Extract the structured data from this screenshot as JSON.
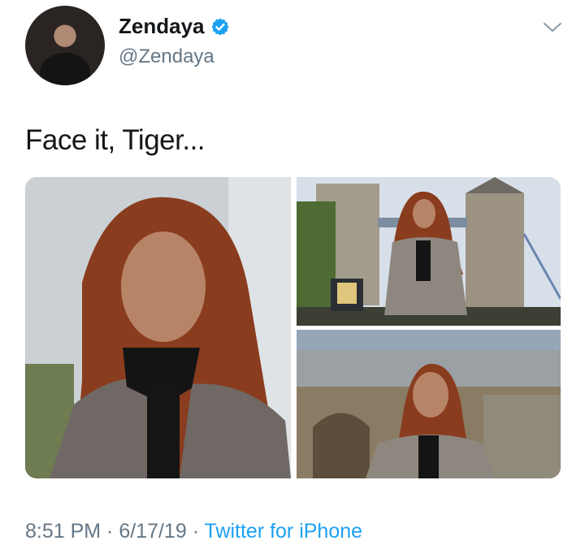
{
  "tweet": {
    "display_name": "Zendaya",
    "handle": "@Zendaya",
    "verified": true,
    "text": "Face it, Tiger...",
    "media_count": 3
  },
  "footer": {
    "time": "8:51 PM",
    "separator1": " · ",
    "date": "6/17/19",
    "separator2": " · ",
    "source": "Twitter for iPhone"
  },
  "colors": {
    "text_primary": "#14171a",
    "text_secondary": "#657786",
    "brand_blue": "#1da1f2"
  },
  "icons": {
    "verified": "verified-badge-icon",
    "menu": "chevron-down-icon"
  }
}
